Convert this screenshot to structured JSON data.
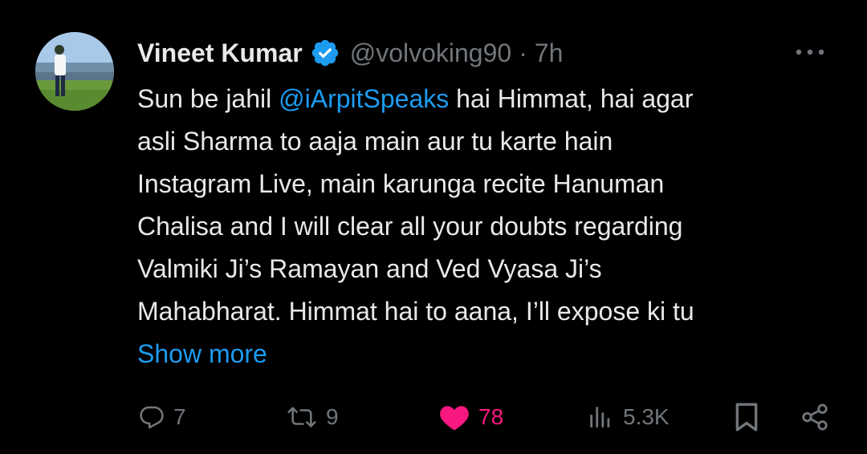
{
  "author": {
    "display_name": "Vineet Kumar",
    "handle": "@volvoking90",
    "separator": "·",
    "time": "7h",
    "verified": true,
    "avatar_icon": "profile-photo"
  },
  "menu_icon": "more-horizontal-icon",
  "body": {
    "line1_pre": "Sun be jahil ",
    "mention": "@iArpitSpeaks",
    "line1_post": " hai Himmat, hai agar",
    "line2": "asli Sharma to aaja main aur tu karte hain",
    "line3": "Instagram Live, main karunga recite Hanuman",
    "line4": "Chalisa and I will clear all your doubts regarding",
    "line5": "Valmiki Ji’s Ramayan and Ved Vyasa Ji’s",
    "line6": "Mahabharat. Himmat hai to aana, I’ll expose ki tu",
    "show_more": "Show more"
  },
  "actions": {
    "reply": {
      "icon": "reply-icon",
      "count": "7"
    },
    "retweet": {
      "icon": "retweet-icon",
      "count": "9"
    },
    "like": {
      "icon": "heart-icon",
      "count": "78",
      "liked": true
    },
    "views": {
      "icon": "views-icon",
      "count": "5.3K"
    },
    "bookmark": {
      "icon": "bookmark-icon"
    },
    "share": {
      "icon": "share-icon"
    }
  },
  "colors": {
    "background": "#000000",
    "text": "#e7e9ea",
    "muted": "#71767b",
    "link": "#1d9bf0",
    "like": "#f91880",
    "verified": "#1d9bf0"
  }
}
